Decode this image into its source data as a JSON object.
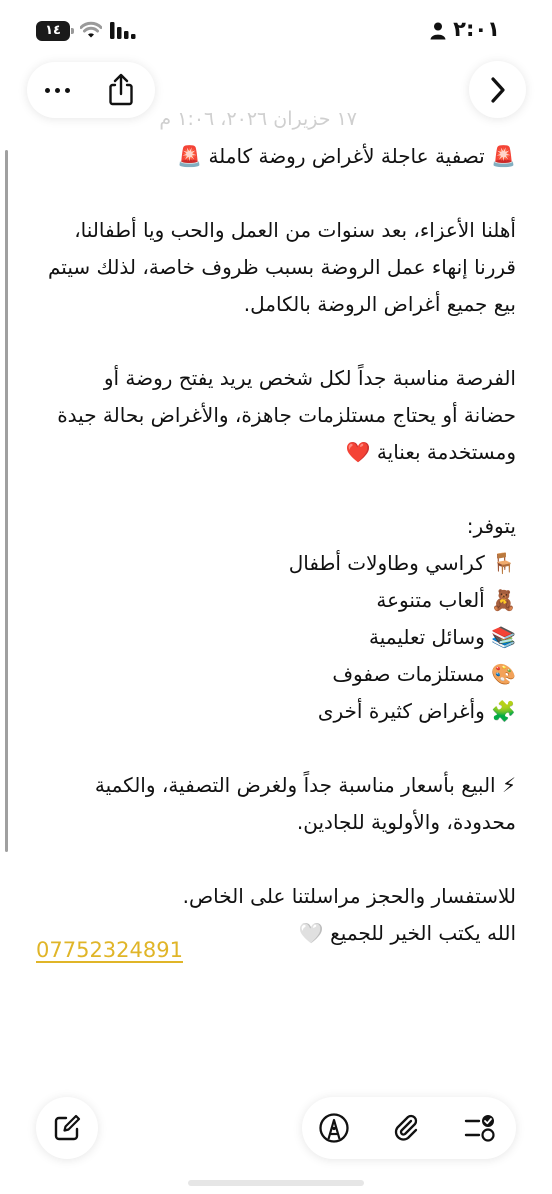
{
  "status_bar": {
    "time": "٢:٠١",
    "battery": "١٤"
  },
  "icons": {
    "more": "ellipsis-icon",
    "share": "share-icon",
    "back": "chevron-right-icon",
    "compose": "compose-icon",
    "markup": "pen-markup-icon",
    "attach": "paperclip-icon",
    "checklist": "checklist-icon"
  },
  "note": {
    "date": "١٧ حزيران ٢٠٢٦، ١:٠٦ م",
    "title_line": "🚨 تصفية عاجلة لأغراض روضة كاملة 🚨",
    "paragraph1": [
      "أهلنا الأعزاء، بعد سنوات من العمل والحب ويا أطفالنا،",
      "قررنا إنهاء عمل الروضة بسبب ظروف خاصة، لذلك سيتم",
      "بيع جميع أغراض الروضة بالكامل."
    ],
    "paragraph2": [
      "الفرصة مناسبة جداً لكل شخص يريد يفتح روضة أو",
      "حضانة أو يحتاج مستلزمات جاهزة، والأغراض بحالة جيدة",
      "ومستخدمة بعناية ❤️"
    ],
    "available_heading": "يتوفر:",
    "available_items": [
      "🪑 كراسي وطاولات أطفال",
      "🧸 ألعاب متنوعة",
      "📚 وسائل تعليمية",
      "🎨 مستلزمات صفوف",
      "🧩 وأغراض كثيرة أخرى"
    ],
    "paragraph3": [
      "⚡ البيع بأسعار مناسبة جداً ولغرض التصفية، والكمية",
      "محدودة، والأولوية للجادين."
    ],
    "paragraph4": [
      "للاستفسار والحجز مراسلتنا على الخاص.",
      "الله يكتب الخير للجميع 🤍"
    ],
    "phone": "07752324891"
  },
  "colors": {
    "link": "#e0b528",
    "text": "#111111",
    "date": "#cfcfcf"
  }
}
